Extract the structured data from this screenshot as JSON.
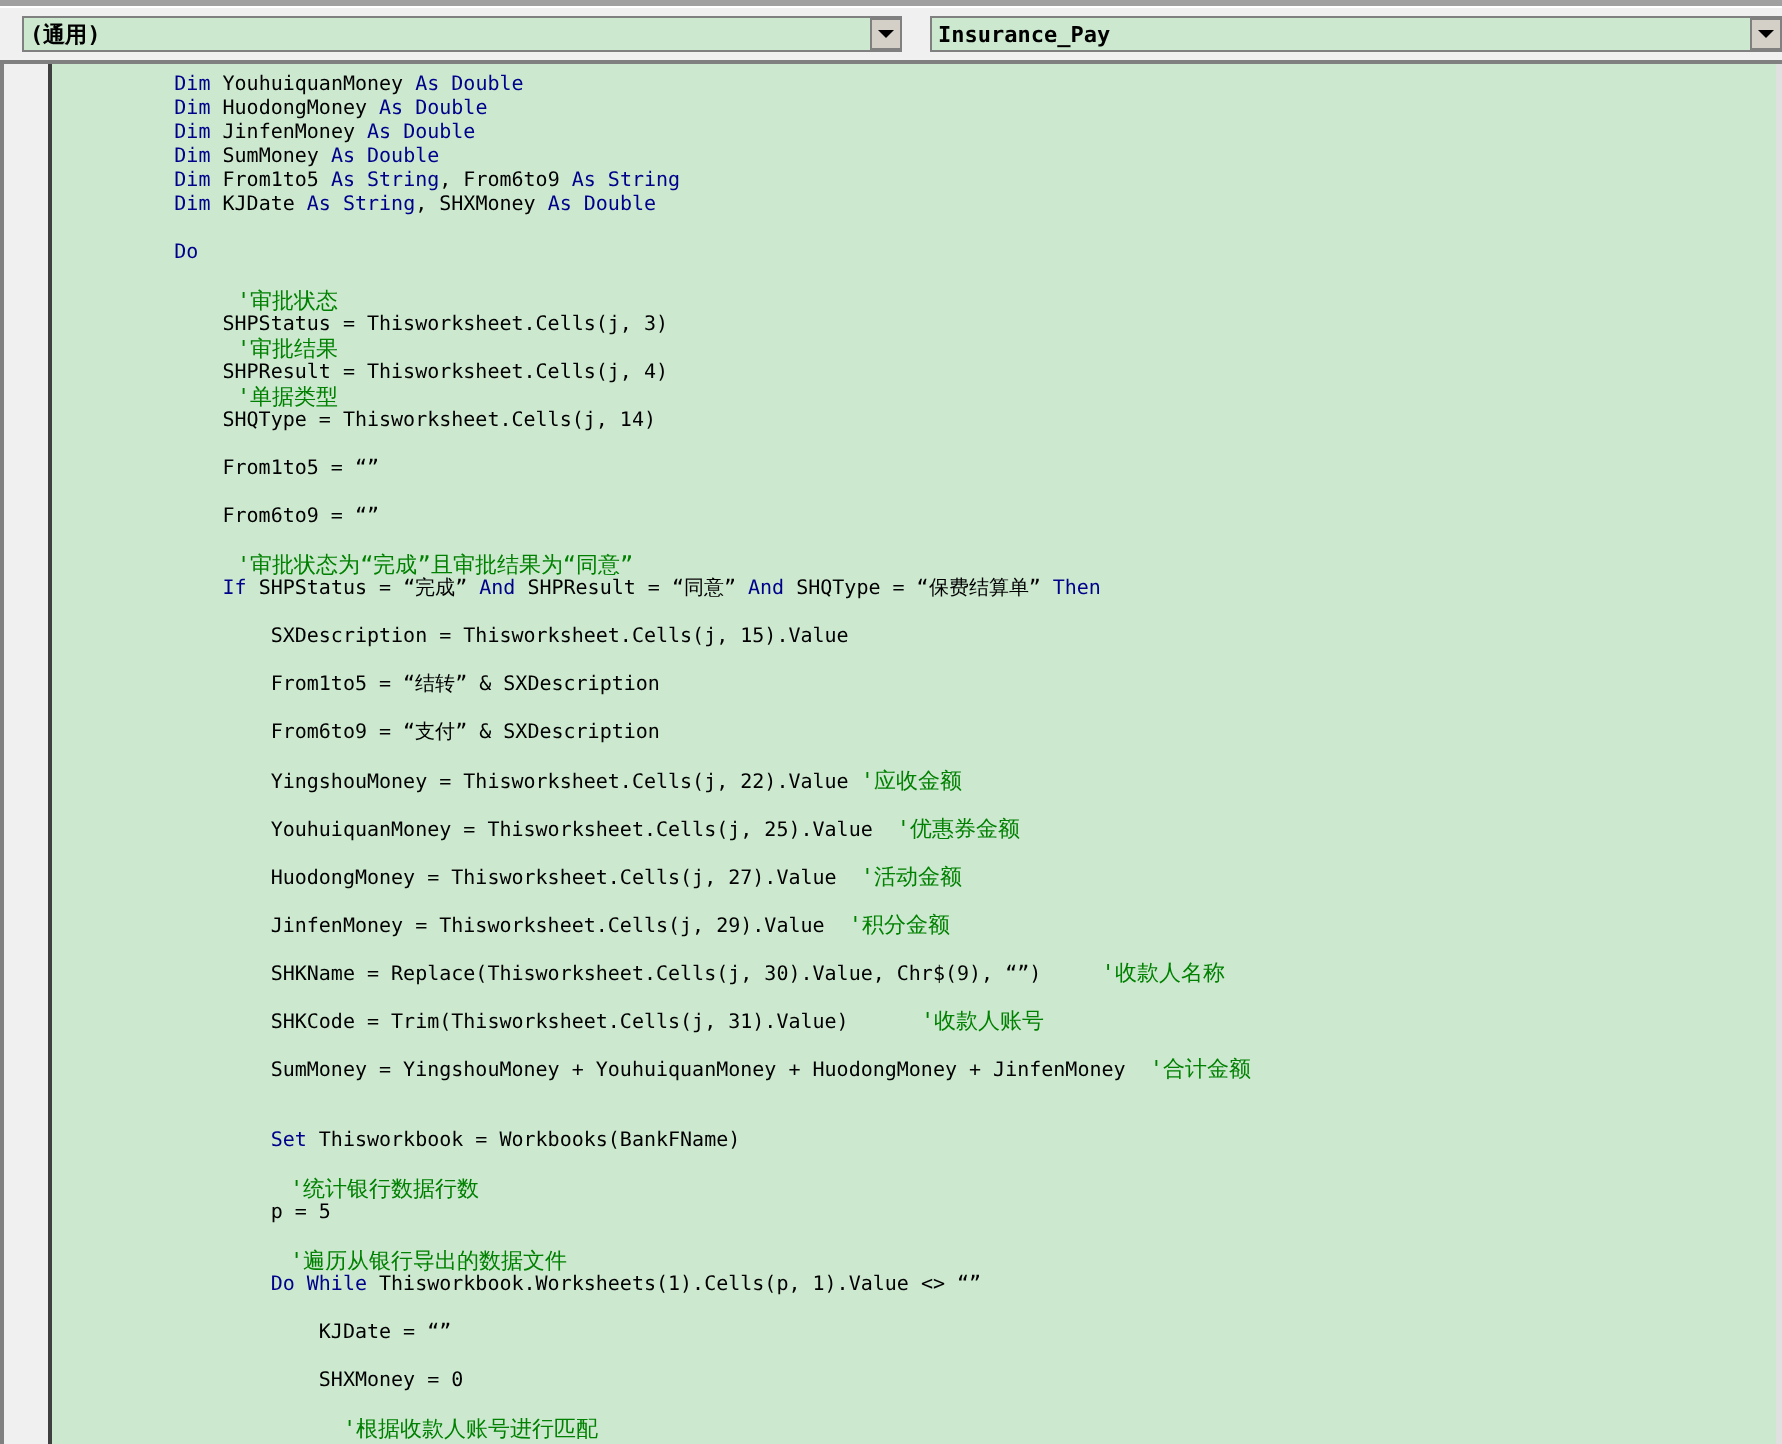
{
  "object_dropdown": {
    "value": "(通用)"
  },
  "procedure_dropdown": {
    "value": "Insurance_Pay"
  },
  "code_lines": [
    {
      "kind": "code",
      "parts": [
        {
          "kind": "keyword",
          "text": "        Dim"
        },
        {
          "kind": "plain",
          "text": " YouhuiquanMoney "
        },
        {
          "kind": "keyword",
          "text": "As Double"
        }
      ]
    },
    {
      "kind": "code",
      "parts": [
        {
          "kind": "keyword",
          "text": "        Dim"
        },
        {
          "kind": "plain",
          "text": " HuodongMoney "
        },
        {
          "kind": "keyword",
          "text": "As Double"
        }
      ]
    },
    {
      "kind": "code",
      "parts": [
        {
          "kind": "keyword",
          "text": "        Dim"
        },
        {
          "kind": "plain",
          "text": " JinfenMoney "
        },
        {
          "kind": "keyword",
          "text": "As Double"
        }
      ]
    },
    {
      "kind": "code",
      "parts": [
        {
          "kind": "keyword",
          "text": "        Dim"
        },
        {
          "kind": "plain",
          "text": " SumMoney "
        },
        {
          "kind": "keyword",
          "text": "As Double"
        }
      ]
    },
    {
      "kind": "code",
      "parts": [
        {
          "kind": "keyword",
          "text": "        Dim"
        },
        {
          "kind": "plain",
          "text": " From1to5 "
        },
        {
          "kind": "keyword",
          "text": "As String"
        },
        {
          "kind": "plain",
          "text": ", From6to9 "
        },
        {
          "kind": "keyword",
          "text": "As String"
        }
      ]
    },
    {
      "kind": "code",
      "parts": [
        {
          "kind": "keyword",
          "text": "        Dim"
        },
        {
          "kind": "plain",
          "text": " KJDate "
        },
        {
          "kind": "keyword",
          "text": "As String"
        },
        {
          "kind": "plain",
          "text": ", SHXMoney "
        },
        {
          "kind": "keyword",
          "text": "As Double"
        }
      ]
    },
    {
      "kind": "blank"
    },
    {
      "kind": "code",
      "parts": [
        {
          "kind": "keyword",
          "text": "        Do"
        }
      ]
    },
    {
      "kind": "blank"
    },
    {
      "kind": "code",
      "parts": [
        {
          "kind": "comment",
          "text": "            '审批状态"
        }
      ]
    },
    {
      "kind": "code",
      "parts": [
        {
          "kind": "plain",
          "text": "            SHPStatus = Thisworksheet.Cells(j, 3)"
        }
      ]
    },
    {
      "kind": "code",
      "parts": [
        {
          "kind": "comment",
          "text": "            '审批结果"
        }
      ]
    },
    {
      "kind": "code",
      "parts": [
        {
          "kind": "plain",
          "text": "            SHPResult = Thisworksheet.Cells(j, 4)"
        }
      ]
    },
    {
      "kind": "code",
      "parts": [
        {
          "kind": "comment",
          "text": "            '单据类型"
        }
      ]
    },
    {
      "kind": "code",
      "parts": [
        {
          "kind": "plain",
          "text": "            SHQType = Thisworksheet.Cells(j, 14)"
        }
      ]
    },
    {
      "kind": "blank"
    },
    {
      "kind": "code",
      "parts": [
        {
          "kind": "plain",
          "text": "            From1to5 = “”"
        }
      ]
    },
    {
      "kind": "blank"
    },
    {
      "kind": "code",
      "parts": [
        {
          "kind": "plain",
          "text": "            From6to9 = “”"
        }
      ]
    },
    {
      "kind": "blank"
    },
    {
      "kind": "code",
      "parts": [
        {
          "kind": "comment",
          "text": "            '审批状态为“完成”且审批结果为“同意”"
        }
      ]
    },
    {
      "kind": "code",
      "parts": [
        {
          "kind": "keyword",
          "text": "            If"
        },
        {
          "kind": "plain",
          "text": " SHPStatus = “完成” "
        },
        {
          "kind": "keyword",
          "text": "And"
        },
        {
          "kind": "plain",
          "text": " SHPResult = “同意” "
        },
        {
          "kind": "keyword",
          "text": "And"
        },
        {
          "kind": "plain",
          "text": " SHQType = “保费结算单” "
        },
        {
          "kind": "keyword",
          "text": "Then"
        }
      ]
    },
    {
      "kind": "blank"
    },
    {
      "kind": "code",
      "parts": [
        {
          "kind": "plain",
          "text": "                SXDescription = Thisworksheet.Cells(j, 15).Value"
        }
      ]
    },
    {
      "kind": "blank"
    },
    {
      "kind": "code",
      "parts": [
        {
          "kind": "plain",
          "text": "                From1to5 = “结转” & SXDescription"
        }
      ]
    },
    {
      "kind": "blank"
    },
    {
      "kind": "code",
      "parts": [
        {
          "kind": "plain",
          "text": "                From6to9 = “支付” & SXDescription"
        }
      ]
    },
    {
      "kind": "blank"
    },
    {
      "kind": "code",
      "parts": [
        {
          "kind": "plain",
          "text": "                YingshouMoney = Thisworksheet.Cells(j, 22).Value "
        },
        {
          "kind": "comment",
          "text": "'应收金额"
        }
      ]
    },
    {
      "kind": "blank"
    },
    {
      "kind": "code",
      "parts": [
        {
          "kind": "plain",
          "text": "                YouhuiquanMoney = Thisworksheet.Cells(j, 25).Value  "
        },
        {
          "kind": "comment",
          "text": "'优惠券金额"
        }
      ]
    },
    {
      "kind": "blank"
    },
    {
      "kind": "code",
      "parts": [
        {
          "kind": "plain",
          "text": "                HuodongMoney = Thisworksheet.Cells(j, 27).Value  "
        },
        {
          "kind": "comment",
          "text": "'活动金额"
        }
      ]
    },
    {
      "kind": "blank"
    },
    {
      "kind": "code",
      "parts": [
        {
          "kind": "plain",
          "text": "                JinfenMoney = Thisworksheet.Cells(j, 29).Value  "
        },
        {
          "kind": "comment",
          "text": "'积分金额"
        }
      ]
    },
    {
      "kind": "blank"
    },
    {
      "kind": "code",
      "parts": [
        {
          "kind": "plain",
          "text": "                SHKName = Replace(Thisworksheet.Cells(j, 30).Value, Chr$(9), “”)     "
        },
        {
          "kind": "comment",
          "text": "'收款人名称"
        }
      ]
    },
    {
      "kind": "blank"
    },
    {
      "kind": "code",
      "parts": [
        {
          "kind": "plain",
          "text": "                SHKCode = Trim(Thisworksheet.Cells(j, 31).Value)      "
        },
        {
          "kind": "comment",
          "text": "'收款人账号"
        }
      ]
    },
    {
      "kind": "blank"
    },
    {
      "kind": "code",
      "parts": [
        {
          "kind": "plain",
          "text": "                SumMoney = YingshouMoney + YouhuiquanMoney + HuodongMoney + JinfenMoney  "
        },
        {
          "kind": "comment",
          "text": "'合计金额"
        }
      ]
    },
    {
      "kind": "blank"
    },
    {
      "kind": "blank"
    },
    {
      "kind": "code",
      "parts": [
        {
          "kind": "keyword",
          "text": "                Set"
        },
        {
          "kind": "plain",
          "text": " Thisworkbook = Workbooks(BankFName)"
        }
      ]
    },
    {
      "kind": "blank"
    },
    {
      "kind": "code",
      "parts": [
        {
          "kind": "comment",
          "text": "                '统计银行数据行数"
        }
      ]
    },
    {
      "kind": "code",
      "parts": [
        {
          "kind": "plain",
          "text": "                p = 5"
        }
      ]
    },
    {
      "kind": "blank"
    },
    {
      "kind": "code",
      "parts": [
        {
          "kind": "comment",
          "text": "                '遍历从银行导出的数据文件"
        }
      ]
    },
    {
      "kind": "code",
      "parts": [
        {
          "kind": "keyword",
          "text": "                Do While"
        },
        {
          "kind": "plain",
          "text": " Thisworkbook.Worksheets(1).Cells(p, 1).Value <> “”"
        }
      ]
    },
    {
      "kind": "blank"
    },
    {
      "kind": "code",
      "parts": [
        {
          "kind": "plain",
          "text": "                    KJDate = “”"
        }
      ]
    },
    {
      "kind": "blank"
    },
    {
      "kind": "code",
      "parts": [
        {
          "kind": "plain",
          "text": "                    SHXMoney = 0"
        }
      ]
    },
    {
      "kind": "blank"
    },
    {
      "kind": "code",
      "parts": [
        {
          "kind": "comment",
          "text": "                    '根据收款人账号进行匹配"
        }
      ]
    }
  ]
}
